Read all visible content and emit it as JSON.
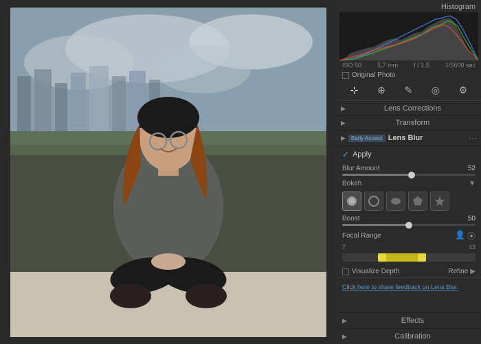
{
  "header": {
    "histogram_title": "Histogram"
  },
  "photo_meta": {
    "iso": "ISO 50",
    "focal_length": "5.7 mm",
    "aperture": "f / 1.5",
    "shutter": "1/5600 sec",
    "original_photo_label": "Original Photo"
  },
  "sections": {
    "lens_corrections": "Lens Corrections",
    "transform": "Transform",
    "lens_blur": "Lens Blur",
    "effects": "Effects",
    "calibration": "Calibration"
  },
  "lens_blur": {
    "early_access_label": "Early Access",
    "apply_label": "Apply",
    "blur_amount_label": "Blur Amount",
    "blur_amount_value": "52",
    "blur_amount_pct": 52,
    "bokeh_label": "Bokeh",
    "boost_label": "Boost",
    "boost_value": "50",
    "boost_pct": 50,
    "focal_range_label": "Focal Range",
    "focal_min": "7",
    "focal_max": "43",
    "visualize_label": "Visualize Depth",
    "refine_label": "Refine",
    "feedback_text": "Click here to share feedback on Lens Blur."
  },
  "tools": {
    "crop": "⊹",
    "healing": "⊕",
    "brush": "✎",
    "radial": "◎",
    "settings": "⚙"
  }
}
